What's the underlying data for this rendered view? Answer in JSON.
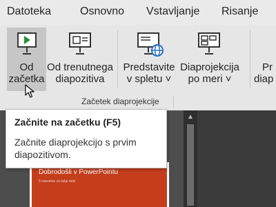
{
  "menu": {
    "tabs": [
      "Datoteka",
      "Osnovno",
      "Vstavljanje",
      "Risanje"
    ]
  },
  "ribbon": {
    "buttons": [
      {
        "line1": "Od",
        "line2": "začetka"
      },
      {
        "line1": "Od trenutnega",
        "line2": "diapozitiva"
      },
      {
        "line1": "Predstavite",
        "line2": "v spletu ˅"
      },
      {
        "line1": "Diaprojekcija",
        "line2": "po meri ˅"
      },
      {
        "line1": "Pr",
        "line2": "diap"
      }
    ],
    "group_label": "Začetek diaprojekcije"
  },
  "tooltip": {
    "title": "Začnite na začetku (F5)",
    "description": "Začnite diaprojekcijo s prvim diapozitivom."
  },
  "slide": {
    "title": "Dobrodošli v PowerPointu",
    "subtitle": "5 nasvetov za lažje delo"
  },
  "colors": {
    "slide_accent": "#c43e1c",
    "play_icon": "#2e8b3a",
    "web_globe": "#2b6fc2"
  }
}
